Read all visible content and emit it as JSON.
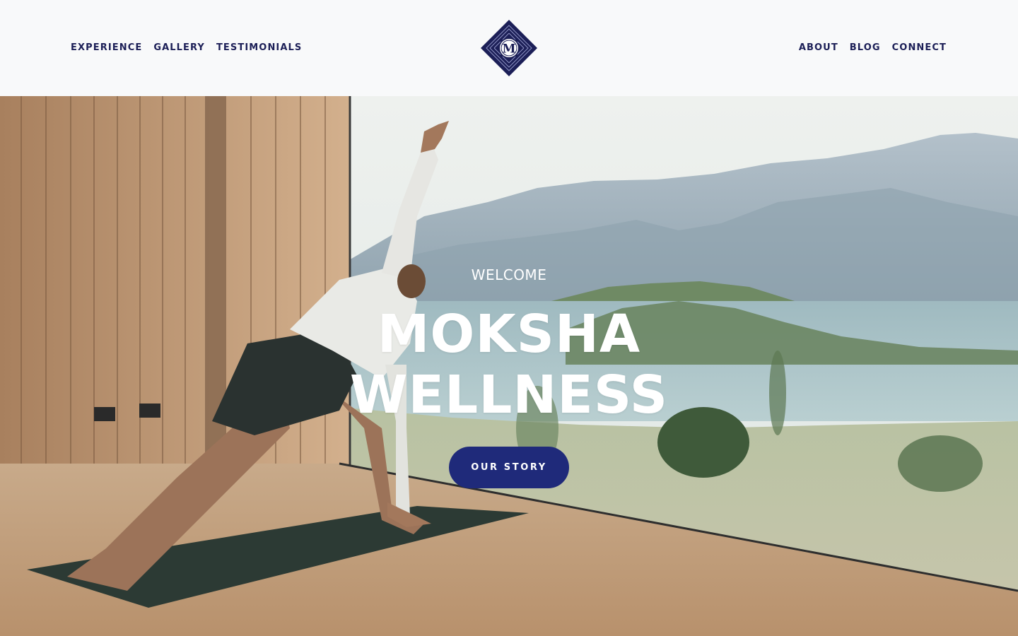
{
  "brand": {
    "logo_letter": "M",
    "navy": "#1c1f57",
    "button_color": "#1f2a7a"
  },
  "nav": {
    "left": [
      "EXPERIENCE",
      "GALLERY",
      "TESTIMONIALS"
    ],
    "right": [
      "ABOUT",
      "BLOG",
      "CONNECT"
    ]
  },
  "hero": {
    "eyebrow": "WELCOME",
    "title_line1": "MOKSHA",
    "title_line2": "WELLNESS",
    "cta_label": "OUR STORY",
    "image_alt": "Person doing a yoga side-angle pose on a mat in a wooden studio overlooking mountains and a lake"
  }
}
